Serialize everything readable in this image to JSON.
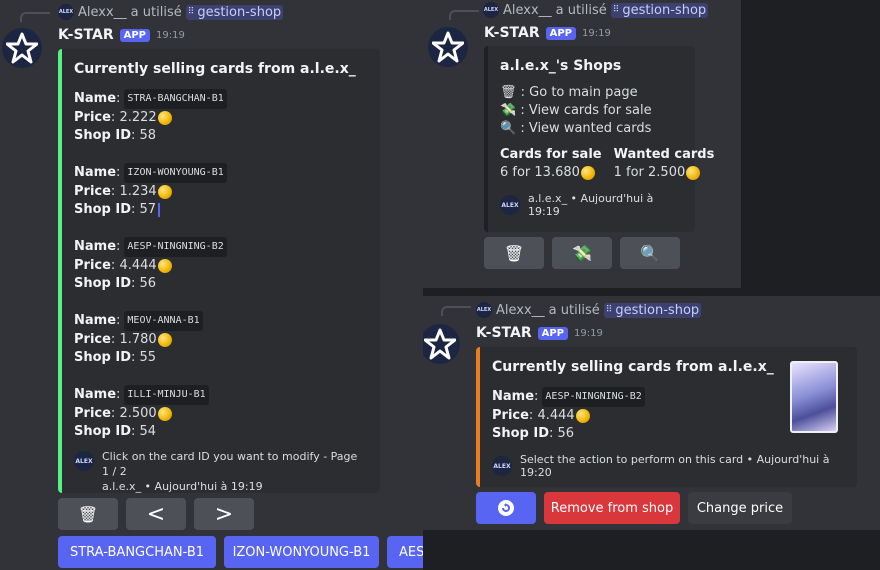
{
  "bot": {
    "name": "K-STAR",
    "tag": "APP"
  },
  "reply": {
    "user": "Alexx__",
    "verb": "a utilisé",
    "command": "gestion-shop",
    "avatar_text": "ALEX"
  },
  "left": {
    "time": "19:19",
    "title": "Currently selling cards from a.l.e.x_",
    "labels": {
      "name": "Name",
      "price": "Price",
      "id": "Shop ID"
    },
    "cards": [
      {
        "name": "STRA-BANGCHAN-B1",
        "price": "2.222",
        "id": "58"
      },
      {
        "name": "IZON-WONYOUNG-B1",
        "price": "1.234",
        "id": "57"
      },
      {
        "name": "AESP-NINGNING-B2",
        "price": "4.444",
        "id": "56"
      },
      {
        "name": "MEOV-ANNA-B1",
        "price": "1.780",
        "id": "55"
      },
      {
        "name": "ILLI-MINJU-B1",
        "price": "2.500",
        "id": "54"
      }
    ],
    "footer_line1": "Click on the card ID you want to modify - Page 1 / 2",
    "footer_line2": "a.l.e.x_ • Aujourd'hui à 19:19",
    "nav": {
      "prev": "<",
      "next": ">"
    },
    "card_buttons": [
      "STRA-BANGCHAN-B1",
      "IZON-WONYOUNG-B1",
      "AES"
    ]
  },
  "shops": {
    "time": "19:19",
    "title": "a.l.e.x_'s Shops",
    "menu": [
      {
        "icon": "🗑",
        "label": ": Go to main page"
      },
      {
        "icon": "💸",
        "label": ": View cards for sale"
      },
      {
        "icon": "🔍",
        "label": ": View wanted cards"
      }
    ],
    "sale_heading": "Cards for sale",
    "sale_value": "6 for 13.680",
    "wanted_heading": "Wanted cards",
    "wanted_value": "1 for 2.500",
    "footer": "a.l.e.x_ • Aujourd'hui à 19:19"
  },
  "detail": {
    "time": "19:19",
    "title": "Currently selling cards from a.l.e.x_",
    "name": "AESP-NINGNING-B2",
    "price": "4.444",
    "id": "56",
    "footer": "Select the action to perform on this card • Aujourd'hui à 19:20",
    "buttons": {
      "remove": "Remove from shop",
      "change": "Change price"
    }
  },
  "colors": {
    "accent": "#5865f2",
    "green_bar": "#57f287",
    "orange_bar": "#e67e22",
    "danger": "#da373c"
  }
}
